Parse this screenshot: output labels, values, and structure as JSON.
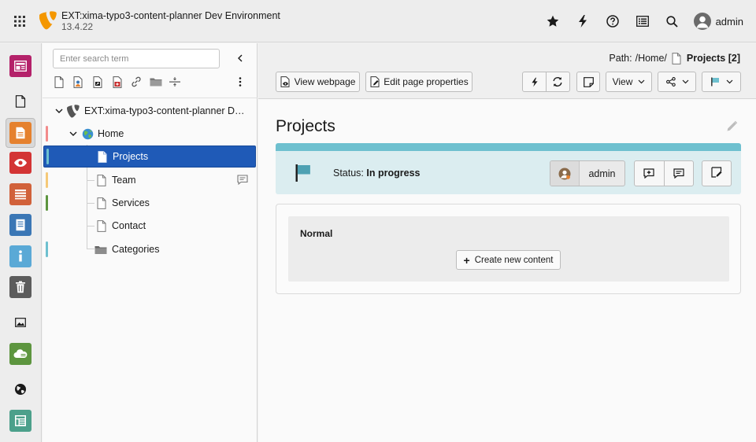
{
  "topbar": {
    "site_name": "EXT:xima-typo3-content-planner Dev Environment",
    "site_version": "13.4.22",
    "icons": [
      "star-icon",
      "bolt-icon",
      "help-icon",
      "list-icon",
      "search-icon"
    ],
    "user": "admin"
  },
  "modules": [
    {
      "name": "dashboard",
      "color": "#b4226a"
    },
    {
      "name": "file-list",
      "color": ""
    },
    {
      "name": "page",
      "color": "#e5812e",
      "active": true
    },
    {
      "name": "view",
      "color": "#d33434"
    },
    {
      "name": "list",
      "color": "#d1613a"
    },
    {
      "name": "form",
      "color": "#3b77b5"
    },
    {
      "name": "info",
      "color": "#5aa9d6"
    },
    {
      "name": "recycler",
      "color": "#5c5c5c"
    },
    {
      "name": "media",
      "color": ""
    },
    {
      "name": "backup",
      "color": "#5d953f"
    },
    {
      "name": "sites",
      "color": ""
    },
    {
      "name": "templates",
      "color": "#4ca08b"
    }
  ],
  "tree": {
    "search_placeholder": "Enter search term",
    "root_label": "EXT:xima-typo3-content-planner D…",
    "items": [
      {
        "label": "Home",
        "marker": "#f28b8b"
      },
      {
        "label": "Projects",
        "marker": "#6ec0cf",
        "selected": true
      },
      {
        "label": "Team",
        "marker": "#f5c978",
        "has_comment": true
      },
      {
        "label": "Services",
        "marker": "#5d953f"
      },
      {
        "label": "Contact",
        "marker": ""
      },
      {
        "label": "Categories",
        "marker": "#6ec0cf"
      }
    ]
  },
  "docheader": {
    "path_label": "Path:",
    "path_value": "/Home/",
    "path_page": "Projects [2]",
    "view_webpage": "View webpage",
    "edit_page_properties": "Edit page properties",
    "view_menu": "View"
  },
  "page": {
    "title": "Projects",
    "status_label": "Status:",
    "status_value": "In progress",
    "status_color": "#6ec0cf",
    "assignee": "admin",
    "column_title": "Normal",
    "create_new_content": "Create new content"
  }
}
